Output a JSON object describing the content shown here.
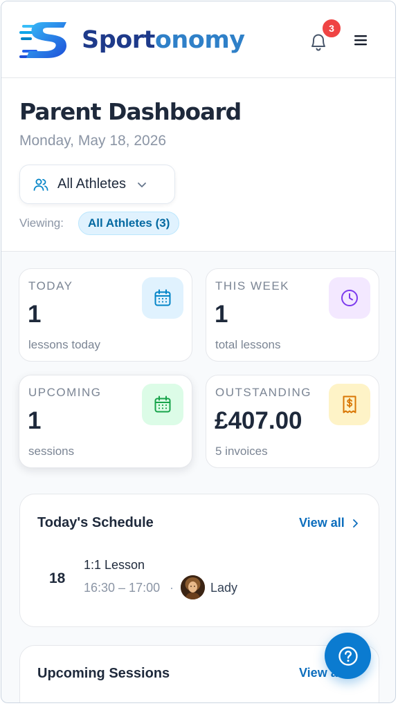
{
  "header": {
    "brand_part1": "Sport",
    "brand_part2": "onomy",
    "notification_count": "3",
    "brand_color_dark": "#1e3a8a",
    "brand_color_light": "#2f80c8"
  },
  "hero": {
    "title": "Parent Dashboard",
    "date": "Monday, May 18, 2026",
    "athlete_select_label": "All Athletes",
    "viewing_label": "Viewing:",
    "viewing_value": "All Athletes (3)"
  },
  "stats": [
    {
      "caption": "TODAY",
      "value": "1",
      "sub": "lessons today",
      "icon": "calendar-icon",
      "color": "#0284c7"
    },
    {
      "caption": "THIS WEEK",
      "value": "1",
      "sub": "total lessons",
      "icon": "clock-icon",
      "color": "#7c3aed"
    },
    {
      "caption": "UPCOMING",
      "value": "1",
      "sub": "sessions",
      "icon": "calendar-icon",
      "color": "#16a34a"
    },
    {
      "caption": "OUTSTANDING",
      "value": "£407.00",
      "sub": "5 invoices",
      "icon": "receipt-icon",
      "color": "#d97706"
    }
  ],
  "schedule": {
    "title": "Today's Schedule",
    "view_all": "View all",
    "items": [
      {
        "day": "18",
        "type": "1:1 Lesson",
        "time": "16:30 – 17:00",
        "athlete": "Lady"
      }
    ]
  },
  "upcoming": {
    "title": "Upcoming Sessions",
    "view_all": "View all"
  }
}
